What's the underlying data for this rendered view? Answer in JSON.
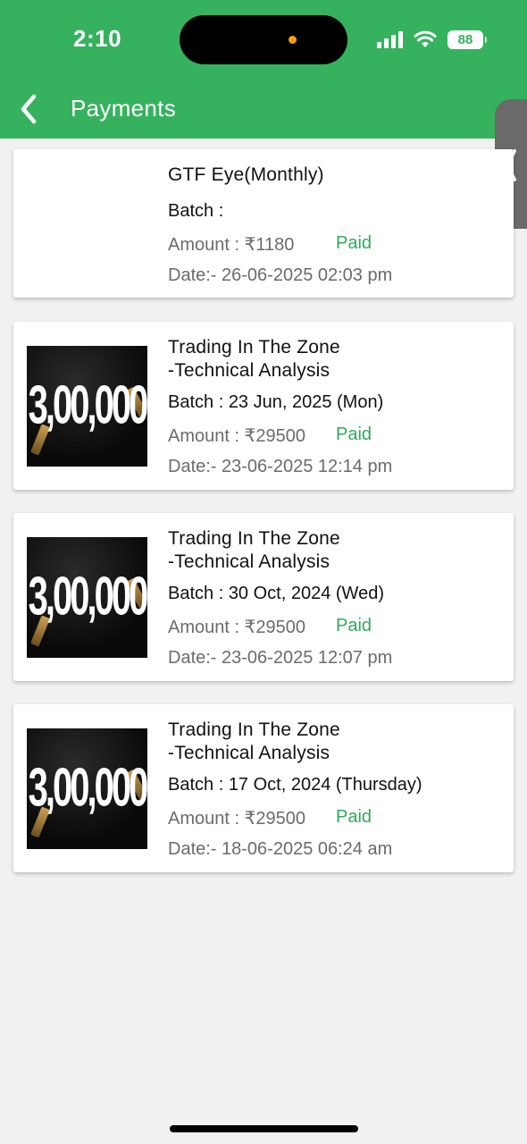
{
  "status_bar": {
    "time": "2:10",
    "battery": "88"
  },
  "header": {
    "title": "Payments",
    "accent_color": "#36b25e"
  },
  "payments": [
    {
      "title": "GTF Eye(Monthly)",
      "batch": "Batch :",
      "amount": "Amount : ₹1180",
      "status": "Paid",
      "date": "Date:- 26-06-2025 02:03 pm"
    },
    {
      "title": "Trading In The Zone\n-Technical Analysis",
      "batch": "Batch : 23 Jun, 2025 (Mon)",
      "amount": "Amount : ₹29500",
      "status": "Paid",
      "date": "Date:- 23-06-2025 12:14 pm",
      "thumb_text": "3,00,000"
    },
    {
      "title": "Trading In The Zone\n-Technical Analysis",
      "batch": "Batch : 30 Oct, 2024 (Wed)",
      "amount": "Amount : ₹29500",
      "status": "Paid",
      "date": "Date:- 23-06-2025 12:07 pm",
      "thumb_text": "3,00,000"
    },
    {
      "title": "Trading In The Zone\n-Technical Analysis",
      "batch": "Batch : 17 Oct, 2024 (Thursday)",
      "amount": "Amount : ₹29500",
      "status": "Paid",
      "date": "Date:- 18-06-2025 06:24 am",
      "thumb_text": "3,00,000"
    }
  ]
}
